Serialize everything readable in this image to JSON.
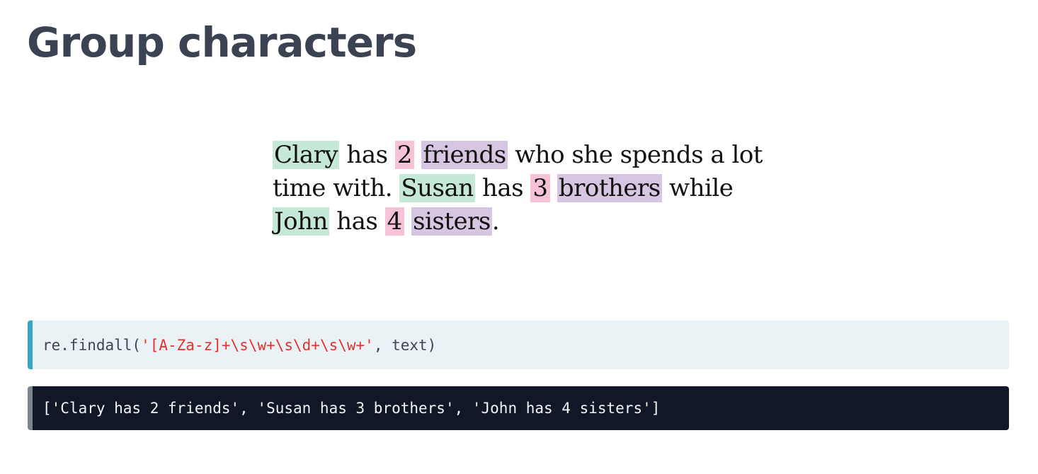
{
  "page": {
    "title": "Group characters"
  },
  "illustration": {
    "segments": [
      {
        "text": "Clary",
        "kind": "name"
      },
      {
        "text": " has ",
        "kind": "plain"
      },
      {
        "text": "2",
        "kind": "number"
      },
      {
        "text": " ",
        "kind": "plain"
      },
      {
        "text": "friends",
        "kind": "noun"
      },
      {
        "text": " who she spends a lot time with. ",
        "kind": "plain"
      },
      {
        "text": "Susan",
        "kind": "name"
      },
      {
        "text": " has ",
        "kind": "plain"
      },
      {
        "text": "3",
        "kind": "number"
      },
      {
        "text": " ",
        "kind": "plain"
      },
      {
        "text": "brothers",
        "kind": "noun"
      },
      {
        "text": " while ",
        "kind": "plain"
      },
      {
        "text": "John",
        "kind": "name"
      },
      {
        "text": " has ",
        "kind": "plain"
      },
      {
        "text": "4",
        "kind": "number"
      },
      {
        "text": " ",
        "kind": "plain"
      },
      {
        "text": "sisters",
        "kind": "noun"
      },
      {
        "text": ".",
        "kind": "plain"
      }
    ],
    "colors": {
      "name": "#c6e8d6",
      "number": "#f6c2d7",
      "noun": "#d6c6e2"
    }
  },
  "code_input": {
    "prefix": "re.findall(",
    "pattern": "'[A-Za-z]+\\s\\w+\\s\\d+\\s\\w+'",
    "suffix": ", text)",
    "accent_color": "#34a7c4",
    "string_color": "#e0332e"
  },
  "code_output": {
    "text": "['Clary has 2 friends', 'Susan has 3 brothers', 'John has 4 sisters']"
  }
}
